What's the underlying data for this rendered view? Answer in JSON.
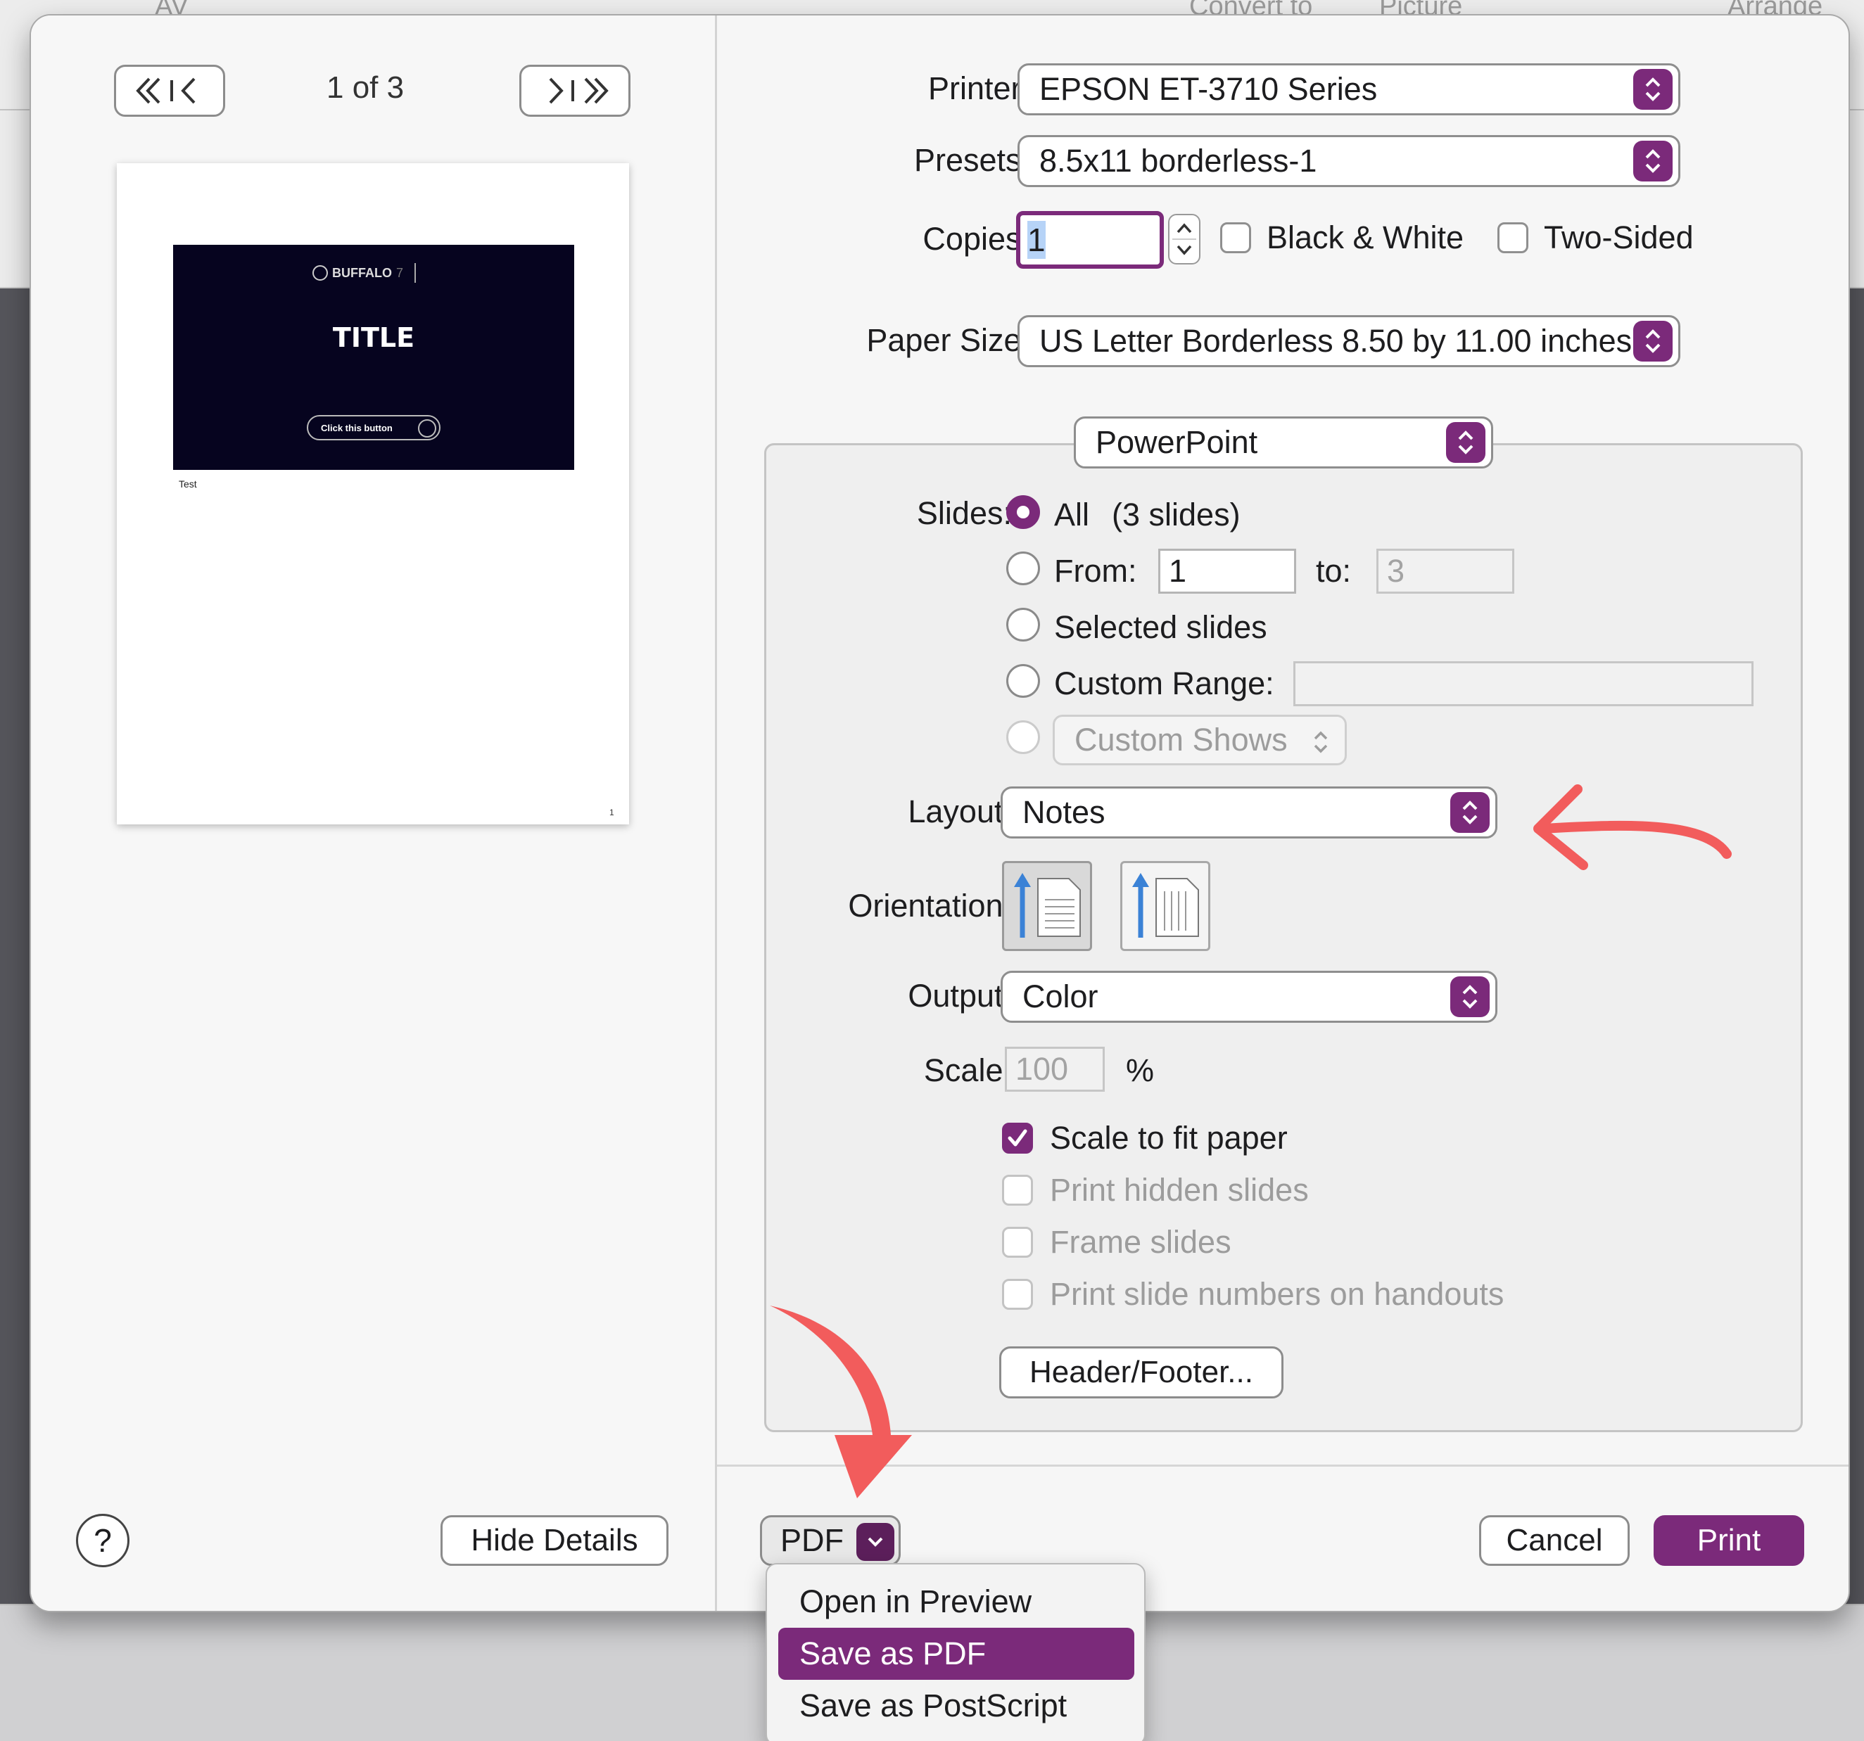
{
  "background_app": {
    "toolbar_items": [
      "AV",
      "Convert to",
      "Picture",
      "Arrange"
    ]
  },
  "preview": {
    "page_indicator": "1 of 3",
    "slide_logo": "BUFFALO",
    "slide_title": "TITLE",
    "slide_button": "Click this button",
    "notes_text": "Test",
    "page_number": "1"
  },
  "left_footer": {
    "help_label": "?",
    "hide_details_label": "Hide Details"
  },
  "printer": {
    "label": "Printer:",
    "value": "EPSON ET-3710 Series"
  },
  "presets": {
    "label": "Presets:",
    "value": "8.5x11 borderless-1"
  },
  "copies": {
    "label": "Copies:",
    "value": "1",
    "black_white_label": "Black & White",
    "two_sided_label": "Two-Sided",
    "black_white_checked": false,
    "two_sided_checked": false
  },
  "paper_size": {
    "label": "Paper Size:",
    "value": "US Letter Borderless 8.50 by 11.00 inches"
  },
  "section_popup": {
    "value": "PowerPoint"
  },
  "slides": {
    "label": "Slides:",
    "all_label": "All",
    "all_count": "(3 slides)",
    "from_label": "From:",
    "from_value": "1",
    "to_label": "to:",
    "to_value": "3",
    "selected_label": "Selected slides",
    "custom_range_label": "Custom Range:",
    "custom_range_value": "",
    "custom_shows_label": "Custom Shows",
    "selected_option": "All"
  },
  "layout": {
    "label": "Layout:",
    "value": "Notes"
  },
  "orientation": {
    "label": "Orientation:",
    "selected": "portrait"
  },
  "output": {
    "label": "Output:",
    "value": "Color"
  },
  "scale": {
    "label": "Scale:",
    "value": "100",
    "unit": "%"
  },
  "options": [
    {
      "label": "Scale to fit paper",
      "checked": true,
      "enabled": true
    },
    {
      "label": "Print hidden slides",
      "checked": false,
      "enabled": false
    },
    {
      "label": "Frame slides",
      "checked": false,
      "enabled": false
    },
    {
      "label": "Print slide numbers on handouts",
      "checked": false,
      "enabled": false
    }
  ],
  "header_footer_label": "Header/Footer...",
  "footer": {
    "pdf_label": "PDF",
    "cancel_label": "Cancel",
    "print_label": "Print"
  },
  "pdf_menu": {
    "items": [
      "Open in Preview",
      "Save as PDF",
      "Save as PostScript"
    ],
    "highlighted": "Save as PDF"
  },
  "colors": {
    "accent": "#7b2a7a",
    "annotation_arrow": "#f25c5c",
    "slide_background": "#06041f"
  }
}
